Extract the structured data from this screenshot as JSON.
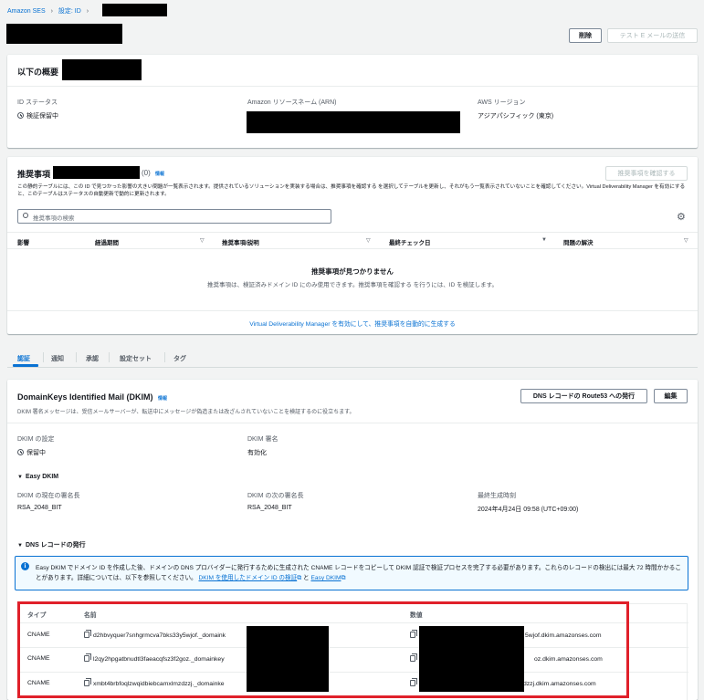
{
  "breadcrumb": {
    "root": "Amazon SES",
    "parent": "設定: ID"
  },
  "header": {
    "delete_button": "削除",
    "test_email_button": "テスト E メールの送信"
  },
  "summary": {
    "title": "以下の概要",
    "id_status_label": "ID ステータス",
    "id_status_value": "検証保留中",
    "arn_label": "Amazon リソースネーム (ARN)",
    "region_label": "AWS リージョン",
    "region_value": "アジアパシフィック (東京)"
  },
  "recommendations": {
    "title": "推奨事項",
    "count": "(0)",
    "info": "情報",
    "view_button": "推奨事項を確認する",
    "description": "この静的テーブルには、この ID で見つかった影響の大きい問題が一覧表示されます。提供されているソリューションを実装する場合は、推奨事項を確認する を選択してテーブルを更新し、それがもう一覧表示されていないことを確認してください。Virtual Deliverability Manager を有効にすると、このテーブルはステータスの自動更新で動的に更新されます。",
    "search_placeholder": "推奨事項の検索",
    "columns": [
      "影響",
      "経過期間",
      "推奨事項/説明",
      "最終チェック日",
      "問題の解決"
    ],
    "empty_title": "推奨事項が見つかりません",
    "empty_body": "推奨事項は、検証済みドメイン ID にのみ使用できます。推奨事項を確認する を行うには、ID を検証します。",
    "footer_link": "Virtual Deliverability Manager を有効にして、推奨事項を自動的に生成する"
  },
  "tabs": [
    "認証",
    "通知",
    "承認",
    "設定セット",
    "タグ"
  ],
  "dkim": {
    "title": "DomainKeys Identified Mail (DKIM)",
    "info": "情報",
    "route53_button": "DNS レコードの Route53 への発行",
    "edit_button": "編集",
    "description": "DKIM 署名メッセージは、受信メールサーバーが、転送中にメッセージが偽造または改ざんされていないことを検証するのに役立ちます。",
    "config_label": "DKIM の設定",
    "config_value": "保留中",
    "signing_label": "DKIM 署名",
    "signing_value": "有効化",
    "easy_dkim_title": "Easy DKIM",
    "current_signing_label": "DKIM の現在の署名長",
    "current_signing_value": "RSA_2048_BIT",
    "next_signing_label": "DKIM の次の署名長",
    "next_signing_value": "RSA_2048_BIT",
    "last_generated_label": "最終生成時刻",
    "last_generated_value": "2024年4月24日 09:58 (UTC+09:00)",
    "dns_title": "DNS レコードの発行",
    "alert_text": "Easy DKIM でドメイン ID を作成した後、ドメインの DNS プロバイダーに発行するために生成された CNAME レコードをコピーして DKIM 認証で検証プロセスを完了する必要があります。これらのレコードの検出には最大 72 時間かかることがあります。詳細については、以下を参照してください。",
    "alert_link1": "DKIM を使用したドメイン ID の検証",
    "alert_and": "と",
    "alert_link2": "Easy DKIM",
    "table_headers": [
      "タイプ",
      "名前",
      "数値"
    ],
    "records": [
      {
        "type": "CNAME",
        "name": "d2hbvyquer7snhgrmcva7bks33y5wjof._domaink",
        "value": "5wjof.dkim.amazonses.com"
      },
      {
        "type": "CNAME",
        "name": "l2qy2hpgatbnudtl3faeacqfsz3f2goz._domainkey",
        "value": "oz.dkim.amazonses.com"
      },
      {
        "type": "CNAME",
        "name": "xmbt4brbfoqlzwqidbiebcamxlmzdzzj._domainke",
        "value": "dzzj.dkim.amazonses.com"
      }
    ]
  },
  "colors": {
    "link": "#0972d3",
    "highlight_border": "#e0202a",
    "alert_bg": "#f1faff"
  }
}
